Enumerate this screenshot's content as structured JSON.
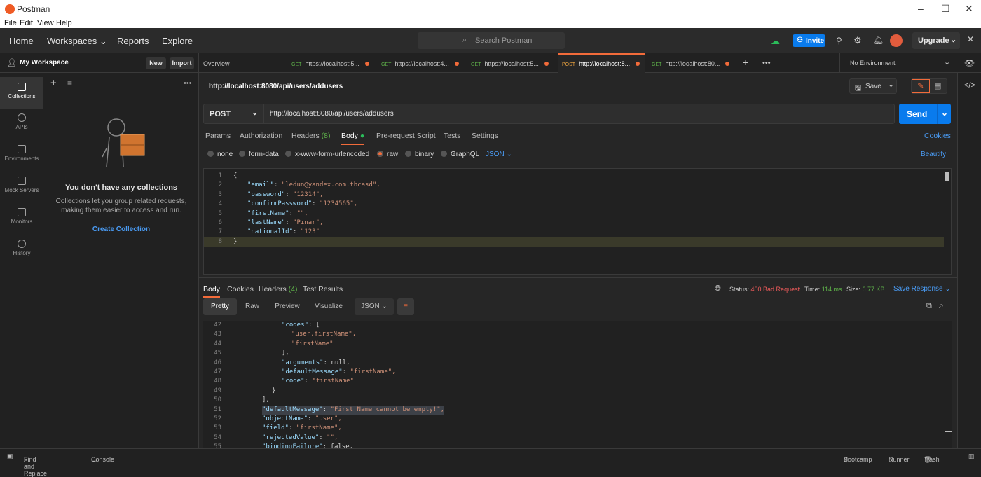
{
  "window": {
    "title": "Postman"
  },
  "menu": [
    "File",
    "Edit",
    "View",
    "Help"
  ],
  "nav": {
    "home": "Home",
    "workspaces": "Workspaces",
    "reports": "Reports",
    "explore": "Explore",
    "search_placeholder": "Search Postman",
    "invite": "Invite",
    "upgrade": "Upgrade"
  },
  "workspace": {
    "name": "My Workspace",
    "new": "New",
    "import": "Import"
  },
  "sidebar": [
    "Collections",
    "APIs",
    "Environments",
    "Mock Servers",
    "Monitors",
    "History"
  ],
  "empty": {
    "title": "You don't have any collections",
    "line1": "Collections let you group related requests,",
    "line2": "making them easier to access and run.",
    "cta": "Create Collection"
  },
  "tabs": {
    "overview": "Overview",
    "items": [
      {
        "method": "GET",
        "url": "https://localhost:5..."
      },
      {
        "method": "GET",
        "url": "https://localhost:4..."
      },
      {
        "method": "GET",
        "url": "https://localhost:5..."
      },
      {
        "method": "POST",
        "url": "http://localhost:8..."
      },
      {
        "method": "GET",
        "url": "http://localhost:80..."
      }
    ],
    "env": "No Environment"
  },
  "request": {
    "title": "http://localhost:8080/api/users/addusers",
    "save": "Save",
    "method": "POST",
    "url": "http://localhost:8080/api/users/addusers",
    "send": "Send",
    "cookies": "Cookies",
    "beautify": "Beautify",
    "format": "JSON"
  },
  "reqtabs": [
    "Params",
    "Authorization",
    "Headers",
    "(8)",
    "Body",
    "Pre-request Script",
    "Tests",
    "Settings"
  ],
  "bodytypes": [
    "none",
    "form-data",
    "x-www-form-urlencoded",
    "raw",
    "binary",
    "GraphQL"
  ],
  "reqbody": [
    {
      "n": "1",
      "t": "{"
    },
    {
      "n": "2",
      "k": "\"email\"",
      "v": "\"ledun@yandex.com.tbcasd\","
    },
    {
      "n": "3",
      "k": "\"password\"",
      "v": "\"12314\","
    },
    {
      "n": "4",
      "k": "\"confirmPassword\"",
      "v": "\"1234565\","
    },
    {
      "n": "5",
      "k": "\"firstName\"",
      "v": "\"\","
    },
    {
      "n": "6",
      "k": "\"lastName\"",
      "v": "\"Pınar\","
    },
    {
      "n": "7",
      "k": "\"nationalId\"",
      "v": "\"123\""
    },
    {
      "n": "8",
      "t": "}"
    }
  ],
  "response": {
    "tabs": [
      "Body",
      "Cookies",
      "Headers",
      "(4)",
      "Test Results"
    ],
    "status_label": "Status:",
    "status": "400 Bad Request",
    "time_label": "Time:",
    "time": "114 ms",
    "size_label": "Size:",
    "size": "6.77 KB",
    "save": "Save Response",
    "views": [
      "Pretty",
      "Raw",
      "Preview",
      "Visualize"
    ],
    "format": "JSON"
  },
  "respbody": [
    {
      "n": "42",
      "i": 10,
      "k": "\"codes\"",
      "v": "["
    },
    {
      "n": "43",
      "i": 12,
      "s": "\"user.firstName\","
    },
    {
      "n": "44",
      "i": 12,
      "s": "\"firstName\""
    },
    {
      "n": "45",
      "i": 10,
      "p": "],"
    },
    {
      "n": "46",
      "i": 10,
      "k": "\"arguments\"",
      "v": "null,"
    },
    {
      "n": "47",
      "i": 10,
      "k": "\"defaultMessage\"",
      "v": "\"firstName\","
    },
    {
      "n": "48",
      "i": 10,
      "k": "\"code\"",
      "v": "\"firstName\""
    },
    {
      "n": "49",
      "i": 8,
      "p": "}"
    },
    {
      "n": "50",
      "i": 6,
      "p": "],"
    },
    {
      "n": "51",
      "i": 6,
      "k": "\"defaultMessage\"",
      "v": "\"First Name cannot be empty!\",",
      "hl": true
    },
    {
      "n": "52",
      "i": 6,
      "k": "\"objectName\"",
      "v": "\"user\","
    },
    {
      "n": "53",
      "i": 6,
      "k": "\"field\"",
      "v": "\"firstName\","
    },
    {
      "n": "54",
      "i": 6,
      "k": "\"rejectedValue\"",
      "v": "\"\","
    },
    {
      "n": "55",
      "i": 6,
      "k": "\"bindingFailure\"",
      "v": "false,"
    }
  ],
  "status": {
    "find": "Find and Replace",
    "console": "Console",
    "bootcamp": "Bootcamp",
    "runner": "Runner",
    "trash": "Trash"
  }
}
